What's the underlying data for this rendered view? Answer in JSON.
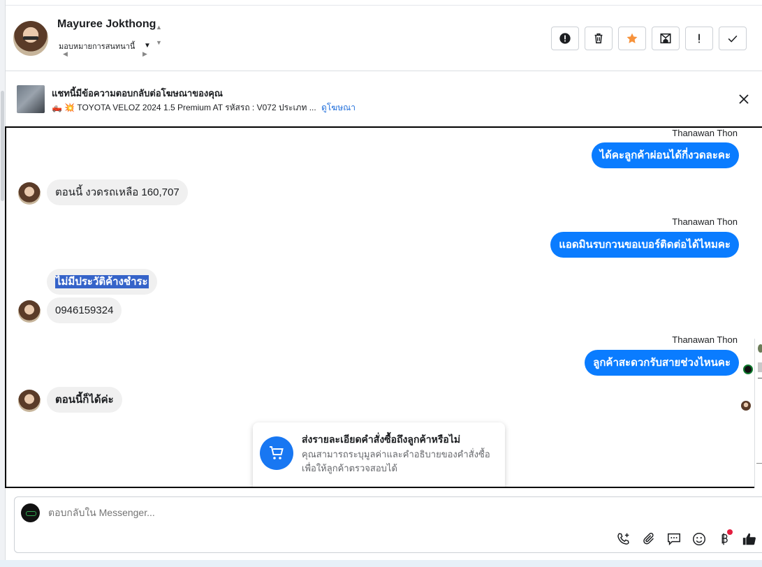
{
  "header": {
    "contact_name": "Mayuree Jokthong",
    "assign_label": "มอบหมายการสนทนานี้",
    "actions": [
      {
        "name": "report-button",
        "icon": "alert-circle-icon"
      },
      {
        "name": "delete-button",
        "icon": "trash-icon"
      },
      {
        "name": "star-button",
        "icon": "star-icon"
      },
      {
        "name": "mark-unread-button",
        "icon": "envelope-icon"
      },
      {
        "name": "follow-up-button",
        "icon": "exclamation-icon"
      },
      {
        "name": "done-button",
        "icon": "check-icon"
      }
    ]
  },
  "ad_banner": {
    "title": "แชทนี้มีข้อความตอบกลับต่อโฆษณาของคุณ",
    "subtitle": "🛻 💥 TOYOTA VELOZ 2024 1.5 Premium AT รหัสรถ : V072 ประเภท ...",
    "link": "ดูโฆษณา"
  },
  "messages": [
    {
      "side": "out",
      "sender": "Thanawan Thon",
      "text": "ได้คะลูกค้าผ่อนได้กี่งวดละคะ"
    },
    {
      "side": "in",
      "text": "ตอนนี้ งวดรถเหลือ 160,707"
    },
    {
      "side": "out",
      "sender": "Thanawan Thon",
      "text": "แอดมินรบกวนขอเบอร์ติดต่อได้ไหมคะ"
    },
    {
      "side": "in",
      "text": "ไม่มีประวัติค้างชำระ"
    },
    {
      "side": "in",
      "text": "0946159324"
    },
    {
      "side": "out",
      "sender": "Thanawan Thon",
      "text": "ลูกค้าสะดวกรับสายช่วงไหนคะ"
    },
    {
      "side": "in",
      "text": "ตอนนี้ก็ได้ค่ะ"
    }
  ],
  "order_popup": {
    "title": "ส่งรายละเอียดคำสั่งซื้อถึงลูกค้าหรือไม่",
    "description": "คุณสามารถระบุมูลค่าและคำอธิบายของคำสั่งซื้อ เพื่อให้ลูกค้าตรวจสอบได้"
  },
  "composer": {
    "placeholder": "ตอบกลับใน Messenger..."
  },
  "colors": {
    "outgoing_bubble": "#0a7cff",
    "incoming_bubble": "#f0f0f0",
    "link": "#216fdb",
    "star": "#f7923a",
    "selection": "#3563c9"
  }
}
